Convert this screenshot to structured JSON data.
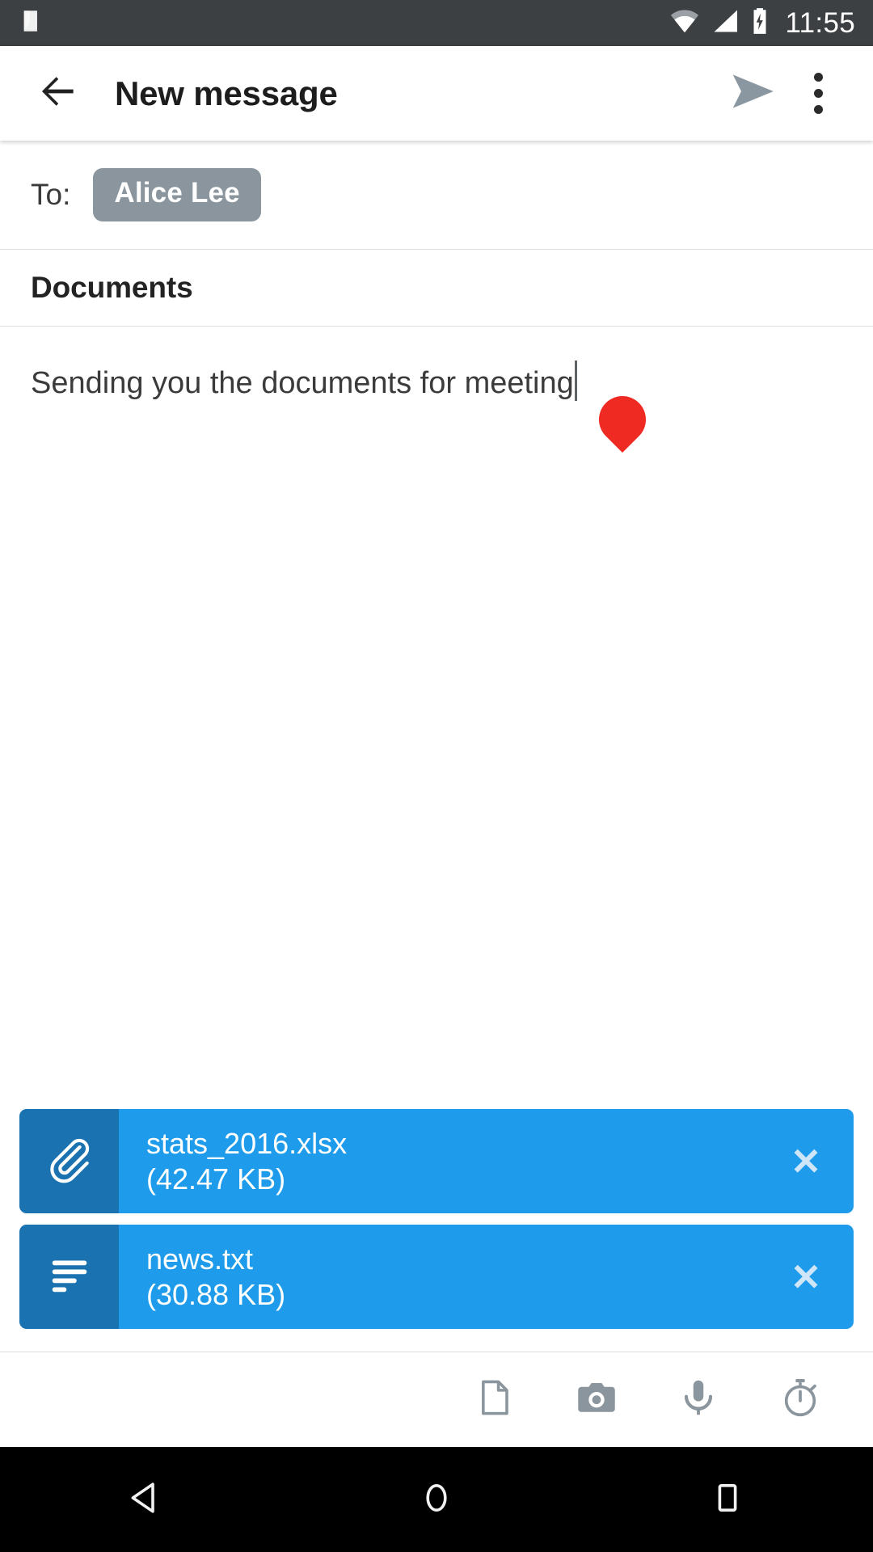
{
  "status_bar": {
    "notification_icon": "android-n-logo-icon",
    "wifi_icon": "wifi-icon",
    "signal_icon": "cellular-signal-icon",
    "battery_icon": "battery-charging-icon",
    "time": "11:55",
    "background_color": "#3c4043"
  },
  "app_bar": {
    "back_icon": "back-arrow-icon",
    "title": "New message",
    "send_icon": "send-icon",
    "overflow_icon": "overflow-menu-icon",
    "send_color": "#8b97a0"
  },
  "compose": {
    "to_label": "To:",
    "recipient": "Alice Lee",
    "recipient_chip_color": "#8a959d",
    "subject": "Documents",
    "body": "Sending you the documents for meeting",
    "cursor_handle_icon": "text-cursor-handle-icon",
    "cursor_handle_color": "#ee2a23"
  },
  "attachments": {
    "remove_label": "✕",
    "chip_color": "#1e9ceb",
    "icon_panel_color": "#1a73b0",
    "items": [
      {
        "name": "stats_2016.xlsx",
        "size": "(42.47 KB)",
        "icon": "paperclip-icon"
      },
      {
        "name": "news.txt",
        "size": "(30.88 KB)",
        "icon": "text-lines-icon"
      }
    ]
  },
  "bottom_toolbar": {
    "items": [
      {
        "icon": "document-attach-icon"
      },
      {
        "icon": "camera-icon"
      },
      {
        "icon": "microphone-icon"
      },
      {
        "icon": "timer-icon"
      }
    ],
    "icon_color": "#8a959d"
  },
  "nav_bar": {
    "back_icon": "nav-back-icon",
    "home_icon": "nav-home-icon",
    "recents_icon": "nav-recents-icon",
    "background_color": "#000000"
  }
}
